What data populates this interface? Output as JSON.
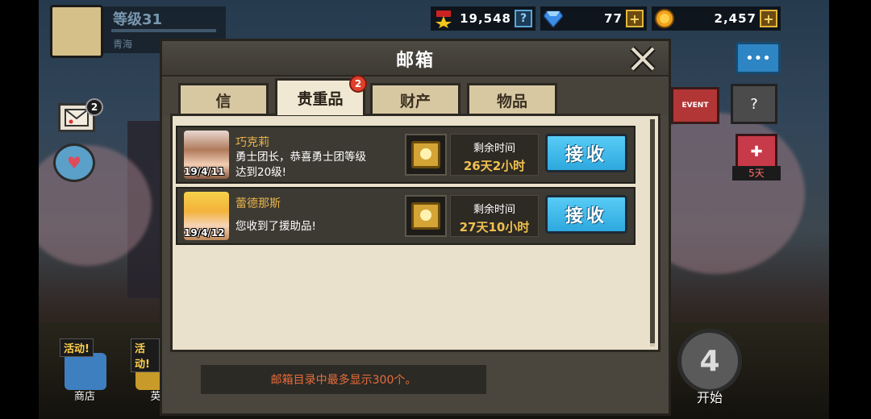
{
  "hud": {
    "level_label": "等级31",
    "server_name": "青海",
    "resources": [
      {
        "icon": "medal-icon",
        "value": "19,548"
      },
      {
        "icon": "diamond-icon",
        "value": "77"
      },
      {
        "icon": "gold-coin-icon",
        "value": "2,457"
      }
    ]
  },
  "side": {
    "mail_count": "2",
    "gift_days": "5天"
  },
  "bottom": {
    "activity_tag": "活动!",
    "shop_label": "商店",
    "second_label": "英",
    "start_label": "开始"
  },
  "modal": {
    "title": "邮箱",
    "tabs": [
      {
        "label": "信"
      },
      {
        "label": "贵重品",
        "badge": "2"
      },
      {
        "label": "财产"
      },
      {
        "label": "物品"
      }
    ],
    "mails": [
      {
        "sender": "巧克莉",
        "message_line1": "勇士团长，恭喜勇士团等级",
        "message_line2": "达到20级!",
        "date": "19/4/11",
        "time_label": "剩余时间",
        "time_left": "26天2小时",
        "receive_label": "接收"
      },
      {
        "sender": "蕾德那斯",
        "message_line1": "您收到了援助品!",
        "message_line2": "",
        "date": "19/4/12",
        "time_label": "剩余时间",
        "time_left": "27天10小时",
        "receive_label": "接收"
      }
    ],
    "footer_note": "邮箱目录中最多显示300个。"
  }
}
